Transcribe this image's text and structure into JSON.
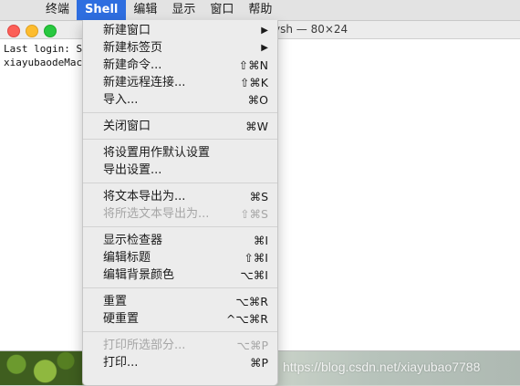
{
  "menubar": {
    "apple_icon": "",
    "items": [
      "终端",
      "Shell",
      "编辑",
      "显示",
      "窗口",
      "帮助"
    ],
    "active_index": 1,
    "active_color": "#2e6ee0"
  },
  "terminal": {
    "title": "ysh — 80×24",
    "lines": [
      "Last login: S",
      "xiayubaodeMac"
    ]
  },
  "shell_menu": {
    "groups": [
      [
        {
          "label": "新建窗口",
          "shortcut": "▶",
          "enabled": true
        },
        {
          "label": "新建标签页",
          "shortcut": "▶",
          "enabled": true
        },
        {
          "label": "新建命令...",
          "shortcut": "⇧⌘N",
          "enabled": true
        },
        {
          "label": "新建远程连接...",
          "shortcut": "⇧⌘K",
          "enabled": true
        },
        {
          "label": "导入...",
          "shortcut": "⌘O",
          "enabled": true
        }
      ],
      [
        {
          "label": "关闭窗口",
          "shortcut": "⌘W",
          "enabled": true
        }
      ],
      [
        {
          "label": "将设置用作默认设置",
          "shortcut": "",
          "enabled": true
        },
        {
          "label": "导出设置...",
          "shortcut": "",
          "enabled": true
        }
      ],
      [
        {
          "label": "将文本导出为...",
          "shortcut": "⌘S",
          "enabled": true
        },
        {
          "label": "将所选文本导出为...",
          "shortcut": "⇧⌘S",
          "enabled": false
        }
      ],
      [
        {
          "label": "显示检查器",
          "shortcut": "⌘I",
          "enabled": true
        },
        {
          "label": "编辑标题",
          "shortcut": "⇧⌘I",
          "enabled": true
        },
        {
          "label": "编辑背景颜色",
          "shortcut": "⌥⌘I",
          "enabled": true
        }
      ],
      [
        {
          "label": "重置",
          "shortcut": "⌥⌘R",
          "enabled": true
        },
        {
          "label": "硬重置",
          "shortcut": "^⌥⌘R",
          "enabled": true
        }
      ],
      [
        {
          "label": "打印所选部分...",
          "shortcut": "⌥⌘P",
          "enabled": false
        },
        {
          "label": "打印...",
          "shortcut": "⌘P",
          "enabled": true
        }
      ]
    ]
  },
  "watermark": "https://blog.csdn.net/xiayubao7788"
}
